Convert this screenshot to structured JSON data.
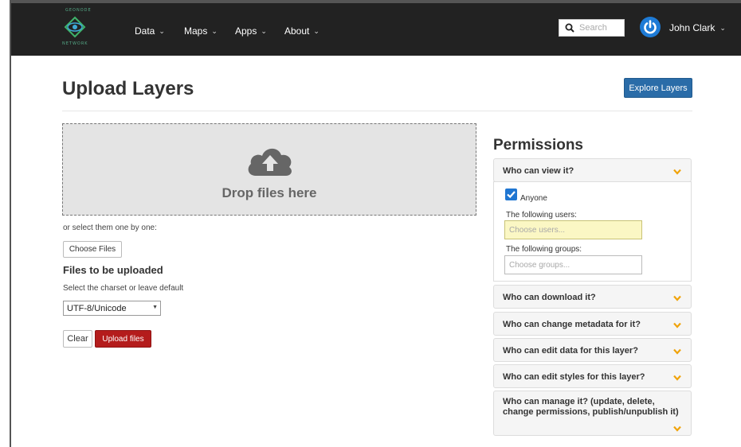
{
  "navbar": {
    "logo_top_text": "GEONODE",
    "logo_bottom_text": "NETWORK",
    "items": [
      {
        "label": "Data",
        "icon": "chevron-down-icon"
      },
      {
        "label": "Maps",
        "icon": "chevron-down-icon"
      },
      {
        "label": "Apps",
        "icon": "chevron-down-icon"
      },
      {
        "label": "About",
        "icon": "chevron-down-icon"
      }
    ],
    "search": {
      "placeholder": "Search",
      "icon": "search-icon"
    },
    "user": {
      "name": "John Clark",
      "avatar_icon": "power-icon",
      "avatar_color": "#1e7bd6"
    }
  },
  "page": {
    "title": "Upload Layers",
    "explore_button": "Explore Layers",
    "explore_color": "#2a6ca8"
  },
  "upload": {
    "dropzone_text": "Drop files here",
    "dropzone_icon": "cloud-upload-icon",
    "select_hint": "or select them one by one:",
    "choose_button": "Choose Files",
    "files_heading": "Files to be uploaded",
    "charset_hint": "Select the charset or leave default",
    "charset_value": "UTF-8/Unicode",
    "clear_button": "Clear",
    "upload_button": "Upload files",
    "upload_color": "#b41c1c"
  },
  "permissions": {
    "title": "Permissions",
    "accent_color": "#f0a30a",
    "view_panel": {
      "heading": "Who can view it?",
      "anyone_label": "Anyone",
      "anyone_checked": true,
      "users_label": "The following users:",
      "users_placeholder": "Choose users...",
      "groups_label": "The following groups:",
      "groups_placeholder": "Choose groups..."
    },
    "panels": [
      "Who can download it?",
      "Who can change metadata for it?",
      "Who can edit data for this layer?",
      "Who can edit styles for this layer?",
      "Who can manage it? (update, delete, change permissions, publish/unpublish it)"
    ]
  }
}
